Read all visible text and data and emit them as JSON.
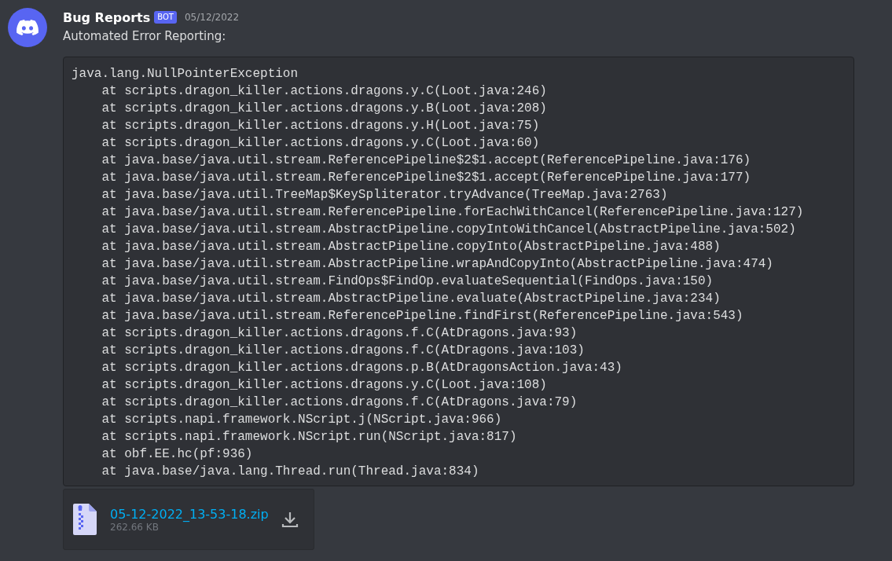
{
  "message": {
    "author": "Bug Reports",
    "badge": "BOT",
    "timestamp": "05/12/2022",
    "text": "Automated Error Reporting:",
    "code_lines": [
      "java.lang.NullPointerException",
      "    at scripts.dragon_killer.actions.dragons.y.C(Loot.java:246)",
      "    at scripts.dragon_killer.actions.dragons.y.B(Loot.java:208)",
      "    at scripts.dragon_killer.actions.dragons.y.H(Loot.java:75)",
      "    at scripts.dragon_killer.actions.dragons.y.C(Loot.java:60)",
      "    at java.base/java.util.stream.ReferencePipeline$2$1.accept(ReferencePipeline.java:176)",
      "    at java.base/java.util.stream.ReferencePipeline$2$1.accept(ReferencePipeline.java:177)",
      "    at java.base/java.util.TreeMap$KeySpliterator.tryAdvance(TreeMap.java:2763)",
      "    at java.base/java.util.stream.ReferencePipeline.forEachWithCancel(ReferencePipeline.java:127)",
      "    at java.base/java.util.stream.AbstractPipeline.copyIntoWithCancel(AbstractPipeline.java:502)",
      "    at java.base/java.util.stream.AbstractPipeline.copyInto(AbstractPipeline.java:488)",
      "    at java.base/java.util.stream.AbstractPipeline.wrapAndCopyInto(AbstractPipeline.java:474)",
      "    at java.base/java.util.stream.FindOps$FindOp.evaluateSequential(FindOps.java:150)",
      "    at java.base/java.util.stream.AbstractPipeline.evaluate(AbstractPipeline.java:234)",
      "    at java.base/java.util.stream.ReferencePipeline.findFirst(ReferencePipeline.java:543)",
      "    at scripts.dragon_killer.actions.dragons.f.C(AtDragons.java:93)",
      "    at scripts.dragon_killer.actions.dragons.f.C(AtDragons.java:103)",
      "    at scripts.dragon_killer.actions.dragons.p.B(AtDragonsAction.java:43)",
      "    at scripts.dragon_killer.actions.dragons.y.C(Loot.java:108)",
      "    at scripts.dragon_killer.actions.dragons.f.C(AtDragons.java:79)",
      "    at scripts.napi.framework.NScript.j(NScript.java:966)",
      "    at scripts.napi.framework.NScript.run(NScript.java:817)",
      "    at obf.EE.hc(pf:936)",
      "    at java.base/java.lang.Thread.run(Thread.java:834)"
    ],
    "attachment": {
      "filename": "05-12-2022_13-53-18.zip",
      "size": "262.66 KB"
    }
  }
}
